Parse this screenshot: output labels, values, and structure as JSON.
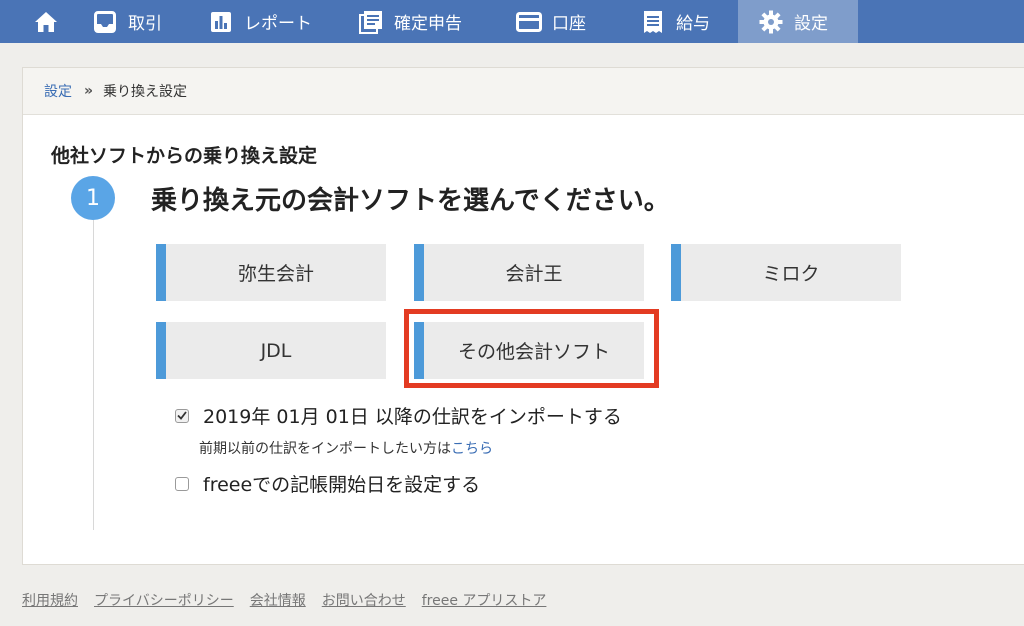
{
  "nav": {
    "items": [
      {
        "label": "",
        "icon": "home-icon"
      },
      {
        "label": "取引",
        "icon": "inbox-icon"
      },
      {
        "label": "レポート",
        "icon": "bar-chart-icon"
      },
      {
        "label": "確定申告",
        "icon": "document-stack-icon"
      },
      {
        "label": "口座",
        "icon": "credit-card-icon"
      },
      {
        "label": "給与",
        "icon": "receipt-icon"
      },
      {
        "label": "設定",
        "icon": "gear-icon",
        "active": true
      }
    ],
    "bg_color": "#4a74b6",
    "active_color": "#7f9dcb"
  },
  "breadcrumb": {
    "root": "設定",
    "separator": "»",
    "current": "乗り換え設定"
  },
  "page": {
    "title": "他社ソフトからの乗り換え設定",
    "step_number": "1",
    "step_title": "乗り換え元の会計ソフトを選んでください。"
  },
  "software": {
    "options": [
      "弥生会計",
      "会計王",
      "ミロク",
      "JDL",
      "その他会計ソフト"
    ],
    "accent_color": "#4d9ad9",
    "highlight_color": "#e33b22"
  },
  "options": {
    "import_after": {
      "label": "2019年 01月 01日 以降の仕訳をインポートする",
      "checked": true
    },
    "prior_note": "前期以前の仕訳をインポートしたい方は",
    "prior_link": "こちら",
    "set_start_date": {
      "label": "freeeでの記帳開始日を設定する",
      "checked": false
    }
  },
  "footer": {
    "links": [
      "利用規約",
      "プライバシーポリシー",
      "会社情報",
      "お問い合わせ",
      "freee アプリストア"
    ]
  }
}
